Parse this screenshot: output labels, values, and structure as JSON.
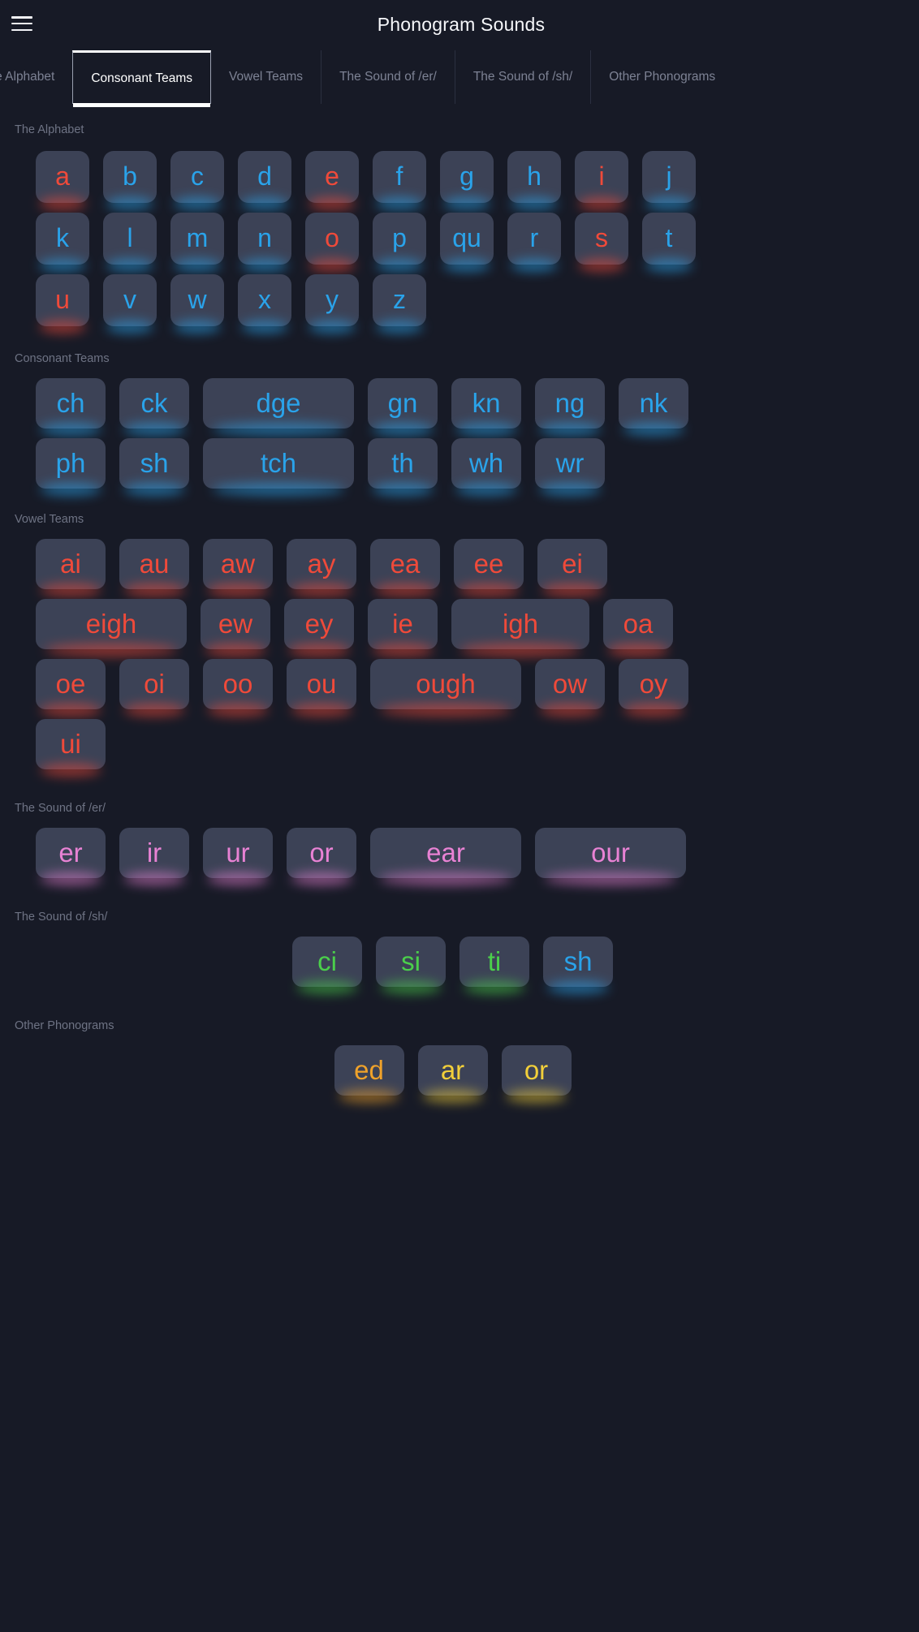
{
  "header": {
    "title": "Phonogram Sounds",
    "menu_icon": "hamburger-menu-icon"
  },
  "tabs": {
    "items": [
      {
        "label": "The Alphabet",
        "selected": false,
        "clipped_left": true
      },
      {
        "label": "Consonant Teams",
        "selected": true
      },
      {
        "label": "Vowel Teams",
        "selected": false
      },
      {
        "label": "The Sound of /er/",
        "selected": false
      },
      {
        "label": "The Sound of /sh/",
        "selected": false
      },
      {
        "label": "Other Phonograms",
        "selected": false
      }
    ]
  },
  "colors": {
    "background": "#171a26",
    "tile": "#3c4256",
    "vowel_red": "#ef4a3a",
    "consonant_blue": "#2aa3ea",
    "er_pink": "#e882d4",
    "sh_green": "#4bcf4b",
    "gold": "#f2cf3a",
    "orange": "#f0a22a",
    "section_label": "#6e7384",
    "tab_inactive": "#7d8294",
    "tab_active": "#ffffff"
  },
  "sections": [
    {
      "id": "sec-alphabet",
      "label": "The Alphabet",
      "align": "left",
      "rows": [
        [
          {
            "t": "a",
            "color": "c-red",
            "w": "w1"
          },
          {
            "t": "b",
            "color": "c-blue",
            "w": "w1"
          },
          {
            "t": "c",
            "color": "c-blue",
            "w": "w1"
          },
          {
            "t": "d",
            "color": "c-blue",
            "w": "w1"
          },
          {
            "t": "e",
            "color": "c-red",
            "w": "w1"
          },
          {
            "t": "f",
            "color": "c-blue",
            "w": "w1"
          },
          {
            "t": "g",
            "color": "c-blue",
            "w": "w1"
          },
          {
            "t": "h",
            "color": "c-blue",
            "w": "w1"
          },
          {
            "t": "i",
            "color": "c-red",
            "w": "w1"
          },
          {
            "t": "j",
            "color": "c-blue",
            "w": "w1"
          }
        ],
        [
          {
            "t": "k",
            "color": "c-blue",
            "w": "w1"
          },
          {
            "t": "l",
            "color": "c-blue",
            "w": "w1"
          },
          {
            "t": "m",
            "color": "c-blue",
            "w": "w1"
          },
          {
            "t": "n",
            "color": "c-blue",
            "w": "w1"
          },
          {
            "t": "o",
            "color": "c-red",
            "w": "w1"
          },
          {
            "t": "p",
            "color": "c-blue",
            "w": "w1"
          },
          {
            "t": "qu",
            "color": "c-blue",
            "w": "w1"
          },
          {
            "t": "r",
            "color": "c-blue",
            "w": "w1"
          },
          {
            "t": "s",
            "color": "c-red",
            "w": "w1"
          },
          {
            "t": "t",
            "color": "c-blue",
            "w": "w1"
          }
        ],
        [
          {
            "t": "u",
            "color": "c-red",
            "w": "w1"
          },
          {
            "t": "v",
            "color": "c-blue",
            "w": "w1"
          },
          {
            "t": "w",
            "color": "c-blue",
            "w": "w1"
          },
          {
            "t": "x",
            "color": "c-blue",
            "w": "w1"
          },
          {
            "t": "y",
            "color": "c-blue",
            "w": "w1"
          },
          {
            "t": "z",
            "color": "c-blue",
            "w": "w1"
          }
        ]
      ]
    },
    {
      "id": "sec-consonants",
      "label": "Consonant Teams",
      "align": "left",
      "rows": [
        [
          {
            "t": "ch",
            "color": "c-blue",
            "w": "w2"
          },
          {
            "t": "ck",
            "color": "c-blue",
            "w": "w2"
          },
          {
            "t": "dge",
            "color": "c-blue",
            "w": "w5"
          },
          {
            "t": "gn",
            "color": "c-blue",
            "w": "w2"
          },
          {
            "t": "kn",
            "color": "c-blue",
            "w": "w2"
          },
          {
            "t": "ng",
            "color": "c-blue",
            "w": "w2"
          },
          {
            "t": "nk",
            "color": "c-blue",
            "w": "w2"
          }
        ],
        [
          {
            "t": "ph",
            "color": "c-blue",
            "w": "w2"
          },
          {
            "t": "sh",
            "color": "c-blue",
            "w": "w2"
          },
          {
            "t": "tch",
            "color": "c-blue",
            "w": "w5"
          },
          {
            "t": "th",
            "color": "c-blue",
            "w": "w2"
          },
          {
            "t": "wh",
            "color": "c-blue",
            "w": "w2"
          },
          {
            "t": "wr",
            "color": "c-blue",
            "w": "w2"
          }
        ]
      ]
    },
    {
      "id": "sec-vowels",
      "label": "Vowel Teams",
      "align": "left",
      "rows": [
        [
          {
            "t": "ai",
            "color": "c-red",
            "w": "w2"
          },
          {
            "t": "au",
            "color": "c-red",
            "w": "w2"
          },
          {
            "t": "aw",
            "color": "c-red",
            "w": "w2"
          },
          {
            "t": "ay",
            "color": "c-red",
            "w": "w2"
          },
          {
            "t": "ea",
            "color": "c-red",
            "w": "w2"
          },
          {
            "t": "ee",
            "color": "c-red",
            "w": "w2"
          },
          {
            "t": "ei",
            "color": "c-red",
            "w": "w2"
          }
        ],
        [
          {
            "t": "eigh",
            "color": "c-red",
            "w": "w5"
          },
          {
            "t": "ew",
            "color": "c-red",
            "w": "w2"
          },
          {
            "t": "ey",
            "color": "c-red",
            "w": "w2"
          },
          {
            "t": "ie",
            "color": "c-red",
            "w": "w2"
          },
          {
            "t": "igh",
            "color": "c-red",
            "w": "w4"
          },
          {
            "t": "oa",
            "color": "c-red",
            "w": "w2"
          }
        ],
        [
          {
            "t": "oe",
            "color": "c-red",
            "w": "w2"
          },
          {
            "t": "oi",
            "color": "c-red",
            "w": "w2"
          },
          {
            "t": "oo",
            "color": "c-red",
            "w": "w2"
          },
          {
            "t": "ou",
            "color": "c-red",
            "w": "w2"
          },
          {
            "t": "ough",
            "color": "c-red",
            "w": "w5"
          },
          {
            "t": "ow",
            "color": "c-red",
            "w": "w2"
          },
          {
            "t": "oy",
            "color": "c-red",
            "w": "w2"
          }
        ],
        [
          {
            "t": "ui",
            "color": "c-red",
            "w": "w2"
          }
        ]
      ]
    },
    {
      "id": "sec-er",
      "label": "The Sound of /er/",
      "align": "left",
      "rows": [
        [
          {
            "t": "er",
            "color": "c-pink",
            "w": "w2"
          },
          {
            "t": "ir",
            "color": "c-pink",
            "w": "w2"
          },
          {
            "t": "ur",
            "color": "c-pink",
            "w": "w2"
          },
          {
            "t": "or",
            "color": "c-pink",
            "w": "w2"
          },
          {
            "t": "ear",
            "color": "c-pink",
            "w": "w5"
          },
          {
            "t": "our",
            "color": "c-pink",
            "w": "w5"
          }
        ]
      ]
    },
    {
      "id": "sec-sh",
      "label": "The Sound of /sh/",
      "align": "center",
      "rows": [
        [
          {
            "t": "ci",
            "color": "c-green",
            "w": "w2"
          },
          {
            "t": "si",
            "color": "c-green",
            "w": "w2"
          },
          {
            "t": "ti",
            "color": "c-green",
            "w": "w2"
          },
          {
            "t": "sh",
            "color": "c-blue",
            "w": "w2"
          }
        ]
      ]
    },
    {
      "id": "sec-other",
      "label": "Other Phonograms",
      "align": "center",
      "rows": [
        [
          {
            "t": "ed",
            "color": "c-orange",
            "w": "w2"
          },
          {
            "t": "ar",
            "color": "c-gold",
            "w": "w2"
          },
          {
            "t": "or",
            "color": "c-gold",
            "w": "w2"
          }
        ]
      ]
    }
  ]
}
